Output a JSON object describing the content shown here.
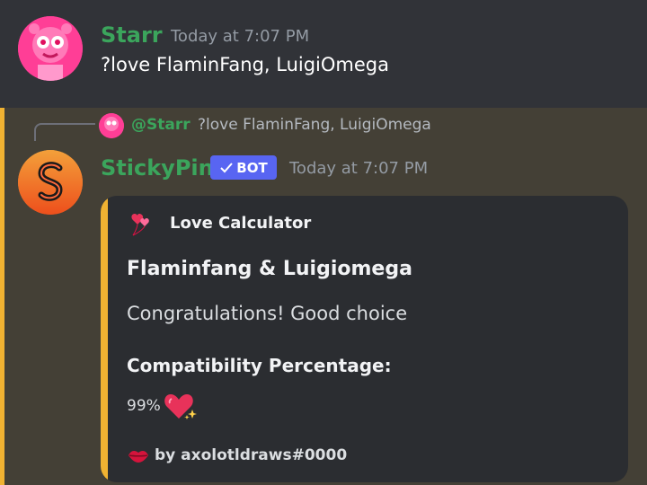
{
  "message1": {
    "author": "Starr",
    "timestamp": "Today at 7:07 PM",
    "content": "?love FlaminFang, LuigiOmega",
    "avatar_icon": "pink-cartoon-avatar",
    "name_color": "#3ba55c"
  },
  "message2": {
    "reply": {
      "mention": "@Starr",
      "text": "?love FlaminFang, LuigiOmega"
    },
    "author": "StickyPin",
    "bot_tag": "BOT",
    "timestamp": "Today at 7:07 PM",
    "avatar_icon": "stickypin-logo",
    "embed": {
      "accent_color": "#f0b232",
      "author_icon": "heart-balloons-icon",
      "author": "Love Calculator",
      "title": "Flaminfang & Luigiomega",
      "description": "Congratulations! Good choice",
      "field_name": "Compatibility Percentage:",
      "field_value": "99%",
      "field_icon": "sparkling-heart-icon",
      "footer_icon": "lips-icon",
      "footer": "by axolotldraws#0000"
    }
  },
  "colors": {
    "background": "#313338",
    "mention_highlight": "#444036",
    "bot_tag": "#5865f2"
  }
}
